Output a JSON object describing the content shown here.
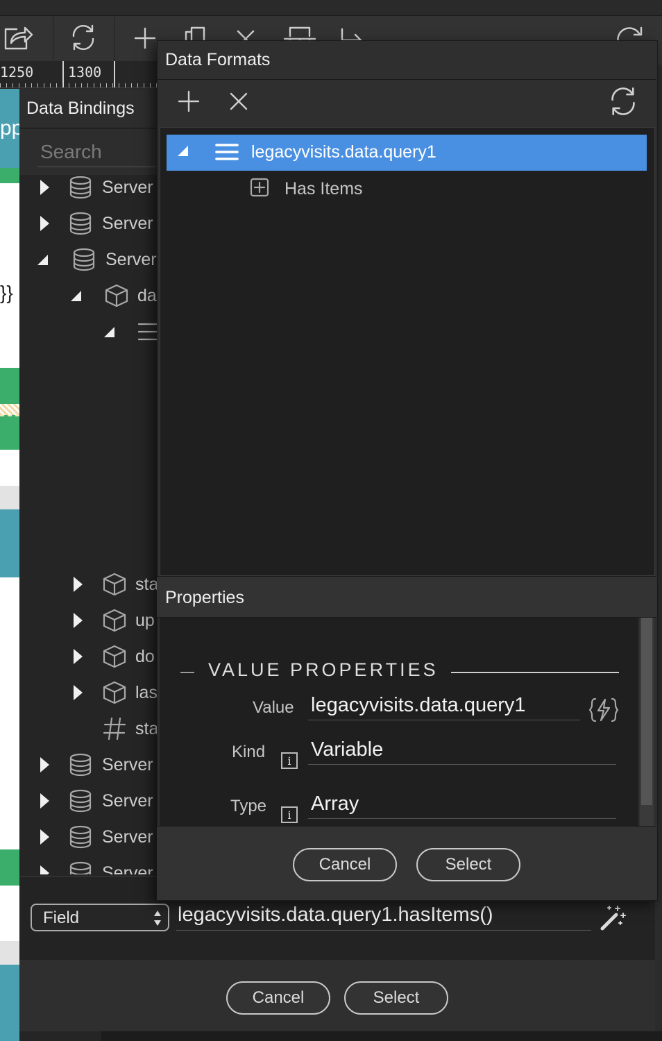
{
  "toolbar": {
    "icons": [
      "share-icon",
      "refresh-icon",
      "add-icon",
      "copy-icon",
      "close-icon",
      "structure-icon",
      "export-icon",
      "redo-icon"
    ]
  },
  "ruler": {
    "ticks": [
      "1250",
      "1300"
    ]
  },
  "canvas_fragment": {
    "text_top": "pp",
    "text_mid": "}}"
  },
  "bindings": {
    "title": "Data Bindings",
    "search_placeholder": "Search",
    "items": [
      {
        "label": "Server",
        "icon": "database-icon",
        "expanded": false
      },
      {
        "label": "Server",
        "icon": "database-icon",
        "expanded": false
      },
      {
        "label": "Server",
        "icon": "database-icon",
        "expanded": true
      },
      {
        "label": "da",
        "icon": "cube-icon",
        "expanded": true
      },
      {
        "label": "",
        "icon": "list-icon",
        "expanded": true
      },
      {
        "label": "sta",
        "icon": "cube-icon",
        "expanded": false
      },
      {
        "label": "up",
        "icon": "cube-icon",
        "expanded": false
      },
      {
        "label": "do",
        "icon": "cube-icon",
        "expanded": false
      },
      {
        "label": "las",
        "icon": "cube-icon",
        "expanded": false
      },
      {
        "label": "sta",
        "icon": "hash-icon",
        "expanded": false
      },
      {
        "label": "Server",
        "icon": "database-icon",
        "expanded": false
      },
      {
        "label": "Server",
        "icon": "database-icon",
        "expanded": false
      },
      {
        "label": "Server",
        "icon": "database-icon",
        "expanded": false
      },
      {
        "label": "Server",
        "icon": "database-icon",
        "expanded": false
      }
    ],
    "field_select": "Field",
    "expression": "legacyvisits.data.query1.hasItems()",
    "cancel": "Cancel",
    "select": "Select"
  },
  "formats": {
    "title": "Data Formats",
    "tree": {
      "root": "legacyvisits.data.query1",
      "child": "Has Items"
    },
    "properties_title": "Properties",
    "section": "VALUE PROPERTIES",
    "value_label": "Value",
    "value": "legacyvisits.data.query1",
    "kind_label": "Kind",
    "kind": "Variable",
    "type_label": "Type",
    "type": "Array",
    "cancel": "Cancel",
    "select": "Select",
    "selection_color": "#4a90e2"
  }
}
